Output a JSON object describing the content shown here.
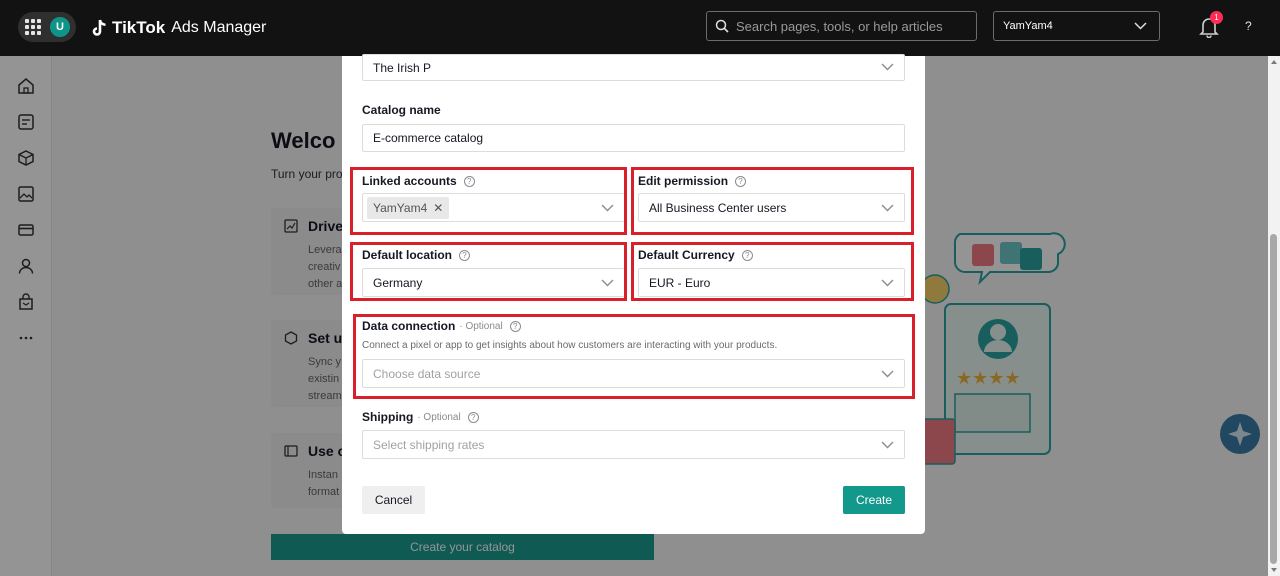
{
  "topbar": {
    "avatar_letter": "U",
    "logo_brand": "TikTok",
    "logo_product": "Ads Manager",
    "search_placeholder": "Search pages, tools, or help articles",
    "account_name": "YamYam4",
    "notification_count": "1",
    "help_label": "?"
  },
  "background_page": {
    "title": "Welco",
    "subtitle": "Turn your pro",
    "cards": [
      {
        "title": "Drive",
        "lines": [
          "Levera",
          "creativ",
          "other a"
        ]
      },
      {
        "title": "Set u",
        "lines": [
          "Sync y",
          "existin",
          "stream"
        ]
      },
      {
        "title": "Use c",
        "lines": [
          "Instan",
          "format"
        ]
      }
    ],
    "create_button_label": "Create your catalog"
  },
  "modal": {
    "business_center_value": "The Irish P",
    "catalog_name_label": "Catalog name",
    "catalog_name_value": "E-commerce catalog",
    "linked_accounts_label": "Linked accounts",
    "linked_accounts_chip": "YamYam4",
    "edit_permission_label": "Edit permission",
    "edit_permission_value": "All Business Center users",
    "default_location_label": "Default location",
    "default_location_value": "Germany",
    "default_currency_label": "Default Currency",
    "default_currency_value": "EUR - Euro",
    "data_connection_label": "Data connection",
    "optional_tag": "· Optional",
    "data_connection_desc": "Connect a pixel or app to get insights about how customers are interacting with your products.",
    "data_connection_placeholder": "Choose data source",
    "shipping_label": "Shipping",
    "shipping_placeholder": "Select shipping rates",
    "cancel_label": "Cancel",
    "create_label": "Create"
  },
  "colors": {
    "topbar_bg": "#121212",
    "accent_teal": "#12998b",
    "highlight_red": "#d9202a",
    "badge_red": "#fe2c55"
  },
  "icons": [
    "apps-grid-icon",
    "tiktok-logo-icon",
    "search-icon",
    "chevron-down-icon",
    "bell-icon",
    "help-icon",
    "home-icon",
    "campaign-icon",
    "catalog-icon",
    "image-icon",
    "payment-icon",
    "user-icon",
    "shop-icon",
    "more-icon",
    "question-circle-icon",
    "close-icon",
    "assistant-icon"
  ]
}
